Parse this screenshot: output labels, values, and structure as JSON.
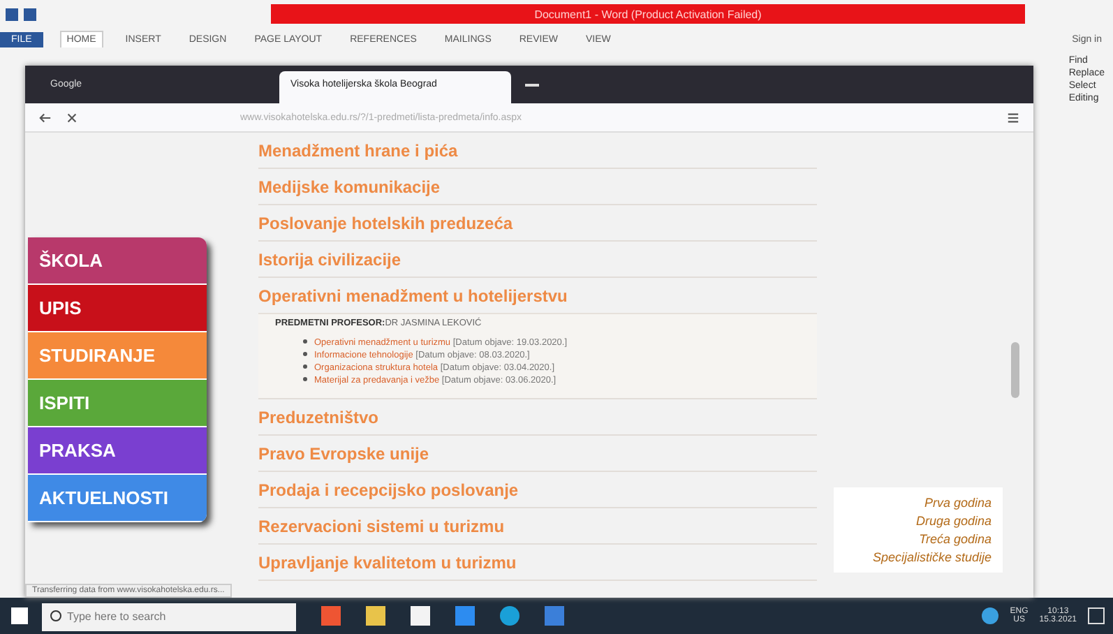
{
  "word": {
    "title": "Document1 - Word (Product Activation Failed)",
    "tabs": [
      {
        "label": "FILE",
        "selected": false
      },
      {
        "label": "HOME",
        "selected": true
      },
      {
        "label": "INSERT",
        "selected": false
      },
      {
        "label": "DESIGN",
        "selected": false
      },
      {
        "label": "PAGE LAYOUT",
        "selected": false
      },
      {
        "label": "REFERENCES",
        "selected": false
      },
      {
        "label": "MAILINGS",
        "selected": false
      },
      {
        "label": "REVIEW",
        "selected": false
      },
      {
        "label": "VIEW",
        "selected": false
      }
    ],
    "sign_in": "Sign in",
    "editing": [
      "Find",
      "Replace",
      "Select",
      "Editing"
    ]
  },
  "browser": {
    "tabs": [
      {
        "label": "Google",
        "selected": false
      },
      {
        "label": "Visoka hotelijerska škola Beograd",
        "selected": true
      }
    ],
    "address": "www.visokahotelska.edu.rs/?/1-predmeti/lista-predmeta/info.aspx",
    "status": "Transferring data from www.visokahotelska.edu.rs..."
  },
  "menu": [
    {
      "label": "ŠKOLA",
      "color": "#b8396b"
    },
    {
      "label": "UPIS",
      "color": "#c8101a"
    },
    {
      "label": "STUDIRANJE",
      "color": "#f5893a"
    },
    {
      "label": "ISPITI",
      "color": "#5aa83a"
    },
    {
      "label": "PRAKSA",
      "color": "#7a3fd0"
    },
    {
      "label": "AKTUELNOSTI",
      "color": "#3f8ae6"
    }
  ],
  "courses": [
    {
      "title": "Menadžment hrane i pića",
      "expanded": false
    },
    {
      "title": "Medijske komunikacije",
      "expanded": false
    },
    {
      "title": "Poslovanje hotelskih preduzeća",
      "expanded": false
    },
    {
      "title": "Istorija civilizacije",
      "expanded": false
    },
    {
      "title": "Operativni menadžment u hotelijerstvu",
      "expanded": true,
      "professor_label": "PREDMETNI PROFESOR:",
      "professor_name": "DR JASMINA LEKOVIĆ",
      "materials": [
        {
          "title": "Operativni menadžment u turizmu",
          "date": "[Datum objave: 19.03.2020.]"
        },
        {
          "title": "Informacione tehnologije",
          "date": "[Datum objave: 08.03.2020.]"
        },
        {
          "title": "Organizaciona struktura hotela",
          "date": "[Datum objave: 03.04.2020.]"
        },
        {
          "title": "Materijal za predavanja i vežbe",
          "date": "[Datum objave: 03.06.2020.]"
        }
      ]
    },
    {
      "title": "Preduzetništvo",
      "expanded": false
    },
    {
      "title": "Pravo Evropske unije",
      "expanded": false
    },
    {
      "title": "Prodaja i recepcijsko poslovanje",
      "expanded": false
    },
    {
      "title": "Rezervacioni sistemi u turizmu",
      "expanded": false
    },
    {
      "title": "Upravljanje kvalitetom u turizmu",
      "expanded": false
    }
  ],
  "years": [
    "Prva godina",
    "Druga godina",
    "Treća godina",
    "Specijalističke studije"
  ],
  "taskbar": {
    "search_placeholder": "Type here to search",
    "lang": [
      "ENG",
      "US"
    ],
    "clock": [
      "10:13",
      "15.3.2021"
    ]
  }
}
